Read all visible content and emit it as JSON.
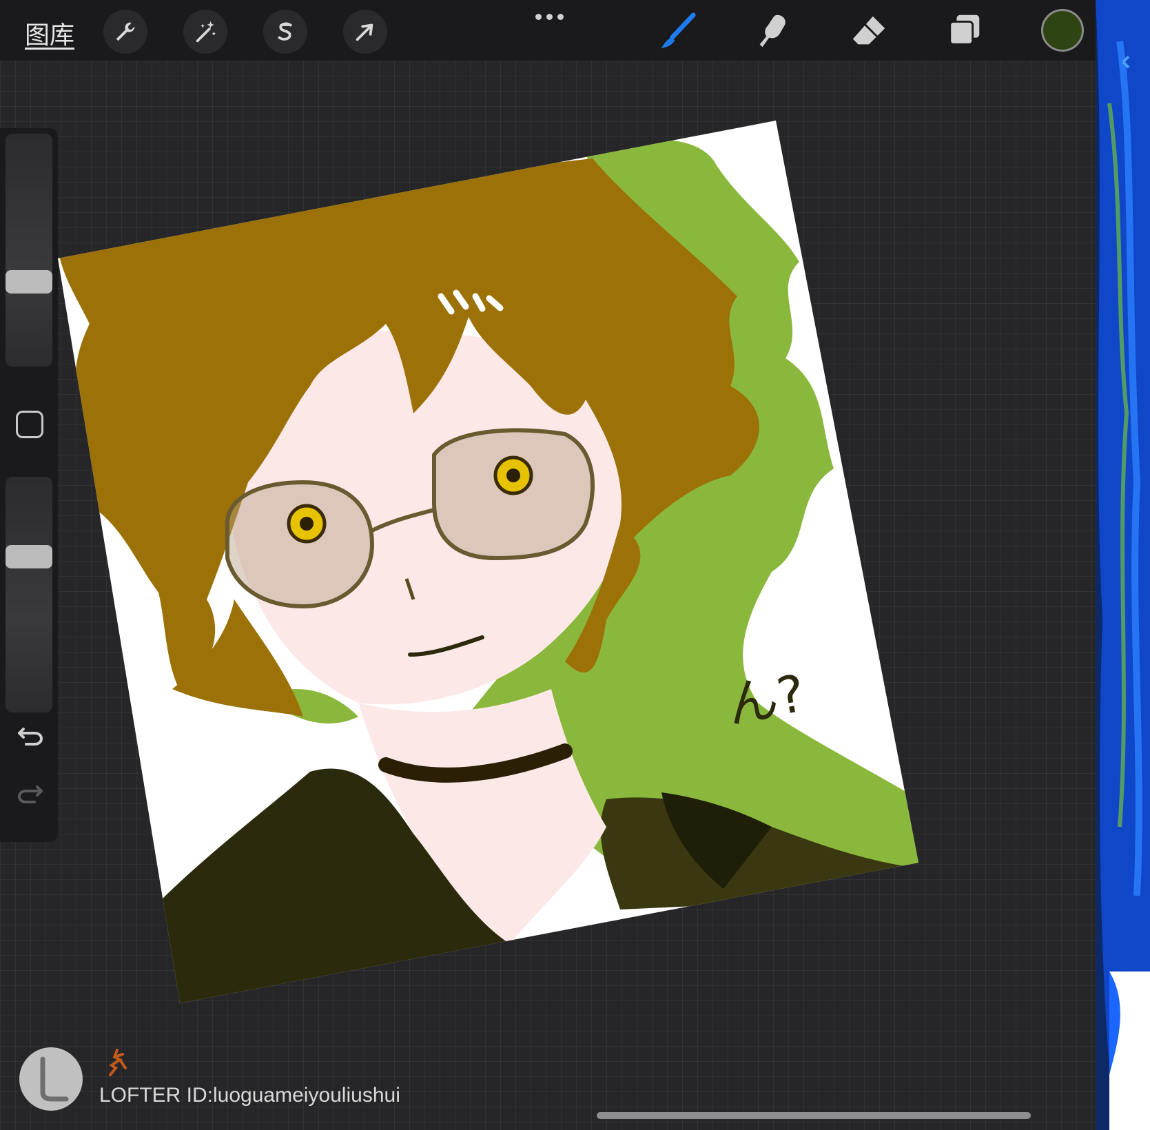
{
  "toolbar": {
    "gallery_label": "图库",
    "left_tools": [
      {
        "name": "actions",
        "icon": "wrench-icon"
      },
      {
        "name": "adjustments",
        "icon": "magic-wand-icon"
      },
      {
        "name": "selection",
        "icon": "selection-s-icon"
      },
      {
        "name": "transform",
        "icon": "arrow-cursor-icon"
      }
    ],
    "more_icon": "more-dots-icon",
    "right_tools": [
      {
        "name": "brush",
        "icon": "brush-icon",
        "active": true,
        "color": "#1e7bf0"
      },
      {
        "name": "smudge",
        "icon": "smudge-finger-icon",
        "active": false
      },
      {
        "name": "eraser",
        "icon": "eraser-icon",
        "active": false
      },
      {
        "name": "layers",
        "icon": "layers-icon",
        "active": false
      }
    ],
    "current_color": "#2e4413"
  },
  "sidebar": {
    "brush_size_level": 0.35,
    "opacity_level": 0.68,
    "modify_icon": "square-modify-icon",
    "undo_icon": "undo-icon",
    "redo_icon": "redo-icon"
  },
  "artwork": {
    "annotation_text": "ん?",
    "palette": {
      "hair": "#9c7208",
      "skin": "#fde8e8",
      "background_splash": "#8ab83c",
      "eyes": "#e6c200",
      "clothing": "#2b2a0c"
    }
  },
  "watermark": {
    "logo_icon": "lofter-logo-icon",
    "text": "LOFTER ID:luoguameiyouliushui"
  }
}
